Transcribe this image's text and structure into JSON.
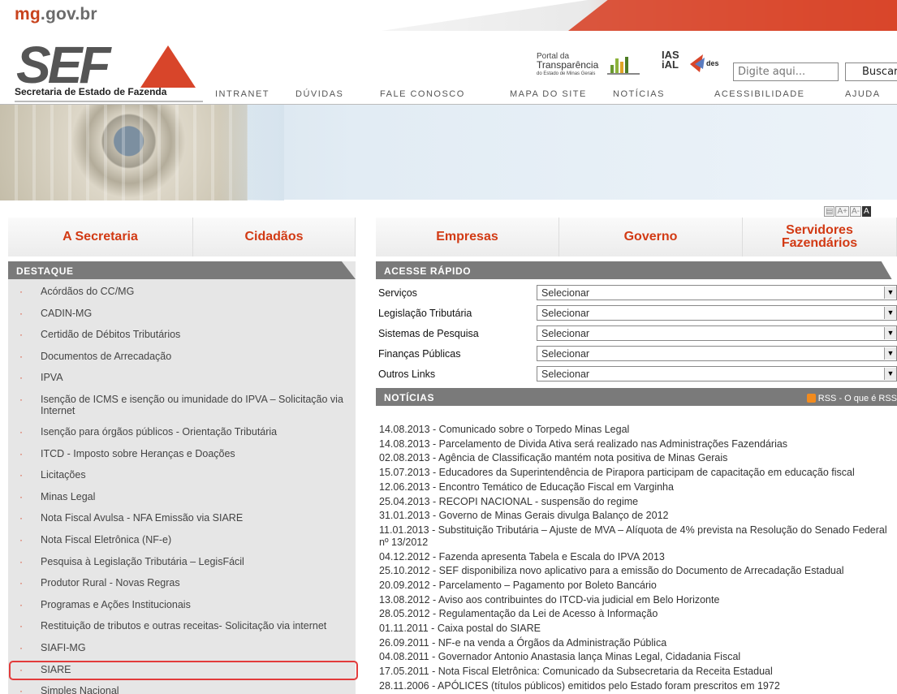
{
  "header": {
    "domain_main": "mg",
    "domain_dot": ".gov.br",
    "logo_text": "SEF",
    "org_name": "Secretaria de Estado de Fazenda",
    "portal_small": "Portal da",
    "portal_big": "Transparência",
    "portal_sub": "do Estado de Minas Gerais",
    "ias_line1": "IAS",
    "ias_line2": "iAL",
    "des_label": "des",
    "search_placeholder": "Digite aqui...",
    "search_button": "Buscar"
  },
  "topnav": [
    "INTRANET",
    "DÚVIDAS",
    "FALE CONOSCO",
    "MAPA DO SITE",
    "NOTÍCIAS",
    "ACESSIBILIDADE",
    "AJUDA"
  ],
  "font_tools": [
    "A+",
    "A-",
    "A"
  ],
  "tabs": [
    "A Secretaria",
    "Cidadãos",
    "Empresas",
    "Governo",
    "Servidores Fazendários"
  ],
  "destaque": {
    "title": "DESTAQUE",
    "items": [
      "Acórdãos do CC/MG",
      "CADIN-MG",
      "Certidão de Débitos Tributários",
      "Documentos de Arrecadação",
      "IPVA",
      "Isenção de ICMS e isenção ou imunidade do IPVA – Solicitação via Internet",
      "Isenção para órgãos públicos - Orientação Tributária",
      "ITCD - Imposto sobre Heranças e Doações",
      "Licitações",
      "Minas Legal",
      "Nota Fiscal Avulsa - NFA Emissão via SIARE",
      "Nota Fiscal Eletrônica (NF-e)",
      "Pesquisa à Legislação Tributária – LegisFácil",
      "Produtor Rural - Novas Regras",
      "Programas e Ações Institucionais",
      "Restituição de tributos e outras receitas- Solicitação via internet",
      "SIAFI-MG",
      "SIARE",
      "Simples Nacional"
    ]
  },
  "acesse": {
    "title": "ACESSE RÁPIDO",
    "rows": [
      {
        "label": "Serviços",
        "value": "Selecionar"
      },
      {
        "label": "Legislação Tributária",
        "value": "Selecionar"
      },
      {
        "label": "Sistemas de Pesquisa",
        "value": "Selecionar"
      },
      {
        "label": "Finanças Públicas",
        "value": "Selecionar"
      },
      {
        "label": "Outros Links",
        "value": "Selecionar"
      }
    ]
  },
  "noticias": {
    "title": "NOTÍCIAS",
    "rss": "RSS - O que é RSS",
    "items": [
      "14.08.2013 - Comunicado sobre o Torpedo Minas Legal",
      "14.08.2013 - Parcelamento de Divida Ativa será realizado nas Administrações Fazendárias",
      "02.08.2013 - Agência de Classificação mantém nota positiva de Minas Gerais",
      "15.07.2013 - Educadores da Superintendência de Pirapora participam de capacitação em educação fiscal",
      "12.06.2013 - Encontro Temático de Educação Fiscal em Varginha",
      "25.04.2013 - RECOPI NACIONAL - suspensão do regime",
      "31.01.2013 - Governo de Minas Gerais divulga Balanço de 2012",
      "11.01.2013 - Substituição Tributária – Ajuste de MVA – Alíquota de 4% prevista na Resolução do Senado Federal nº 13/2012",
      "04.12.2012 - Fazenda apresenta Tabela e Escala do IPVA 2013",
      "25.10.2012 - SEF disponibiliza novo aplicativo para a emissão do Documento de Arrecadação Estadual",
      "20.09.2012 - Parcelamento – Pagamento por Boleto Bancário",
      "13.08.2012 - Aviso aos contribuintes do ITCD-via judicial em Belo Horizonte",
      "28.05.2012 - Regulamentação da Lei de Acesso à Informação",
      "01.11.2011 - Caixa postal do SIARE",
      "26.09.2011 - NF-e na venda a Órgãos da Administração Pública",
      "04.08.2011 - Governador Antonio Anastasia lança Minas Legal, Cidadania Fiscal",
      "17.05.2011 - Nota Fiscal Eletrônica: Comunicado da Subsecretaria da Receita Estadual",
      "28.11.2006 - APÓLICES (títulos públicos) emitidos pelo Estado foram prescritos em 1972"
    ]
  },
  "colors": {
    "accent": "#d8452a",
    "panel_header": "#7a7a7a",
    "panel_bg": "#e6e6e6",
    "highlight": "#e23b3b"
  }
}
